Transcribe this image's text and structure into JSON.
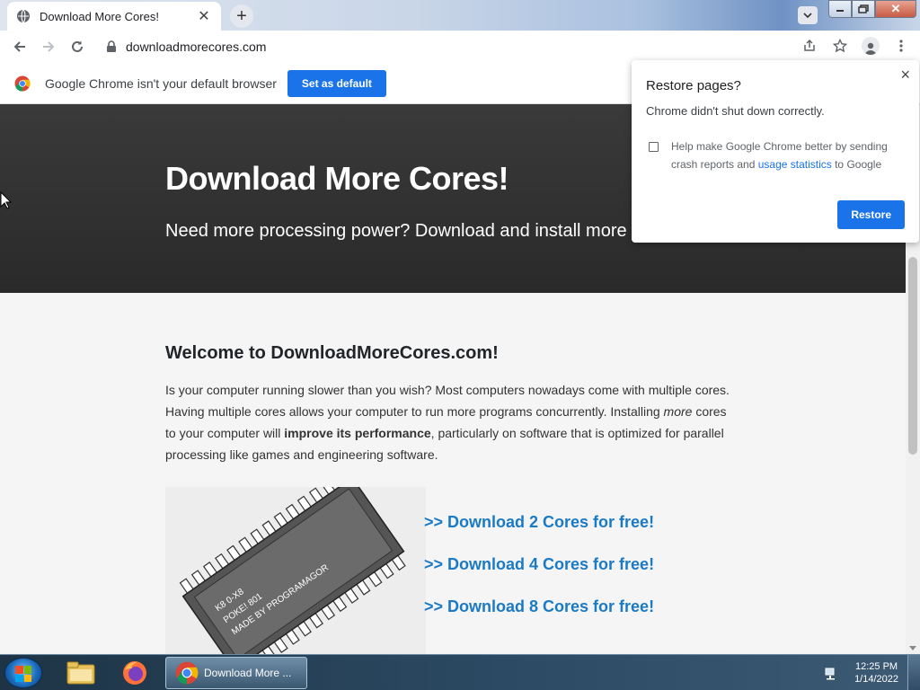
{
  "browser": {
    "tab_title": "Download More Cores!",
    "new_tab_symbol": "+",
    "url": "downloadmorecores.com"
  },
  "infobar": {
    "message": "Google Chrome isn't your default browser",
    "button": "Set as default"
  },
  "page": {
    "hero_title": "Download More Cores!",
    "hero_subtitle": "Need more processing power? Download and install more c",
    "welcome_heading": "Welcome to DownloadMoreCores.com!",
    "para_1": "Is your computer running slower than you wish? Most computers nowadays come with multiple cores. Having multiple cores allows your computer to run more programs concurrently. Installing ",
    "para_em": "more",
    "para_2": " cores to your computer will ",
    "para_bold": "improve its performance",
    "para_3": ", particularly on software that is optimized for parallel processing like games and engineering software.",
    "chip_lines": [
      "K8 0-X8",
      "POKE! 801",
      "MADE BY PROGRAMAGOR"
    ],
    "downloads": [
      ">> Download 2 Cores for free!",
      ">> Download 4 Cores for free!",
      ">> Download 8 Cores for free!"
    ]
  },
  "popup": {
    "title": "Restore pages?",
    "message": "Chrome didn't shut down correctly.",
    "checkbox_text_1": "Help make Google Chrome better by sending crash reports and ",
    "checkbox_link": "usage statistics",
    "checkbox_text_2": " to Google",
    "button": "Restore",
    "close_symbol": "×"
  },
  "taskbar": {
    "active_app_label": "Download More ...",
    "time": "12:25 PM",
    "date": "1/14/2022"
  },
  "colors": {
    "accent": "#1a73e8",
    "link": "#1b7ac4",
    "hero_bg": "#2f2f2f"
  }
}
